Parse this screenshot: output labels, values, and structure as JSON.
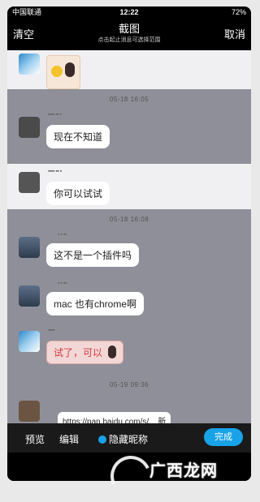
{
  "status_bar": {
    "carrier": "中国联通",
    "time": "12:22",
    "battery": "72%"
  },
  "topbar": {
    "left": "清空",
    "title": "截图",
    "hint": "点击起止消息可选择范围",
    "right": "取消"
  },
  "messages": [
    {
      "type": "sticker"
    },
    {
      "type": "timestamp",
      "text": "05-18 16:05"
    },
    {
      "type": "text",
      "text": "现在不知道"
    },
    {
      "type": "text",
      "text": "你可以试试"
    },
    {
      "type": "timestamp",
      "text": "05-18 16:08"
    },
    {
      "type": "text",
      "text": "这不是一个插件吗"
    },
    {
      "type": "text",
      "text": "mac 也有chrome啊"
    },
    {
      "type": "sticker_text",
      "text": "试了，可以"
    },
    {
      "type": "timestamp",
      "text": "05-19 09:36"
    }
  ],
  "link_preview": "https://pan.baidu.com/s/... 新",
  "toolbar": {
    "preview": "预览",
    "edit": "编辑",
    "hide_nick": "隐藏昵称",
    "done": "完成"
  },
  "watermark": "广西龙网",
  "colors": {
    "accent": "#18a3e8",
    "dim_overlay": "#8f8f99",
    "selected_bg": "#f0f0f3"
  }
}
